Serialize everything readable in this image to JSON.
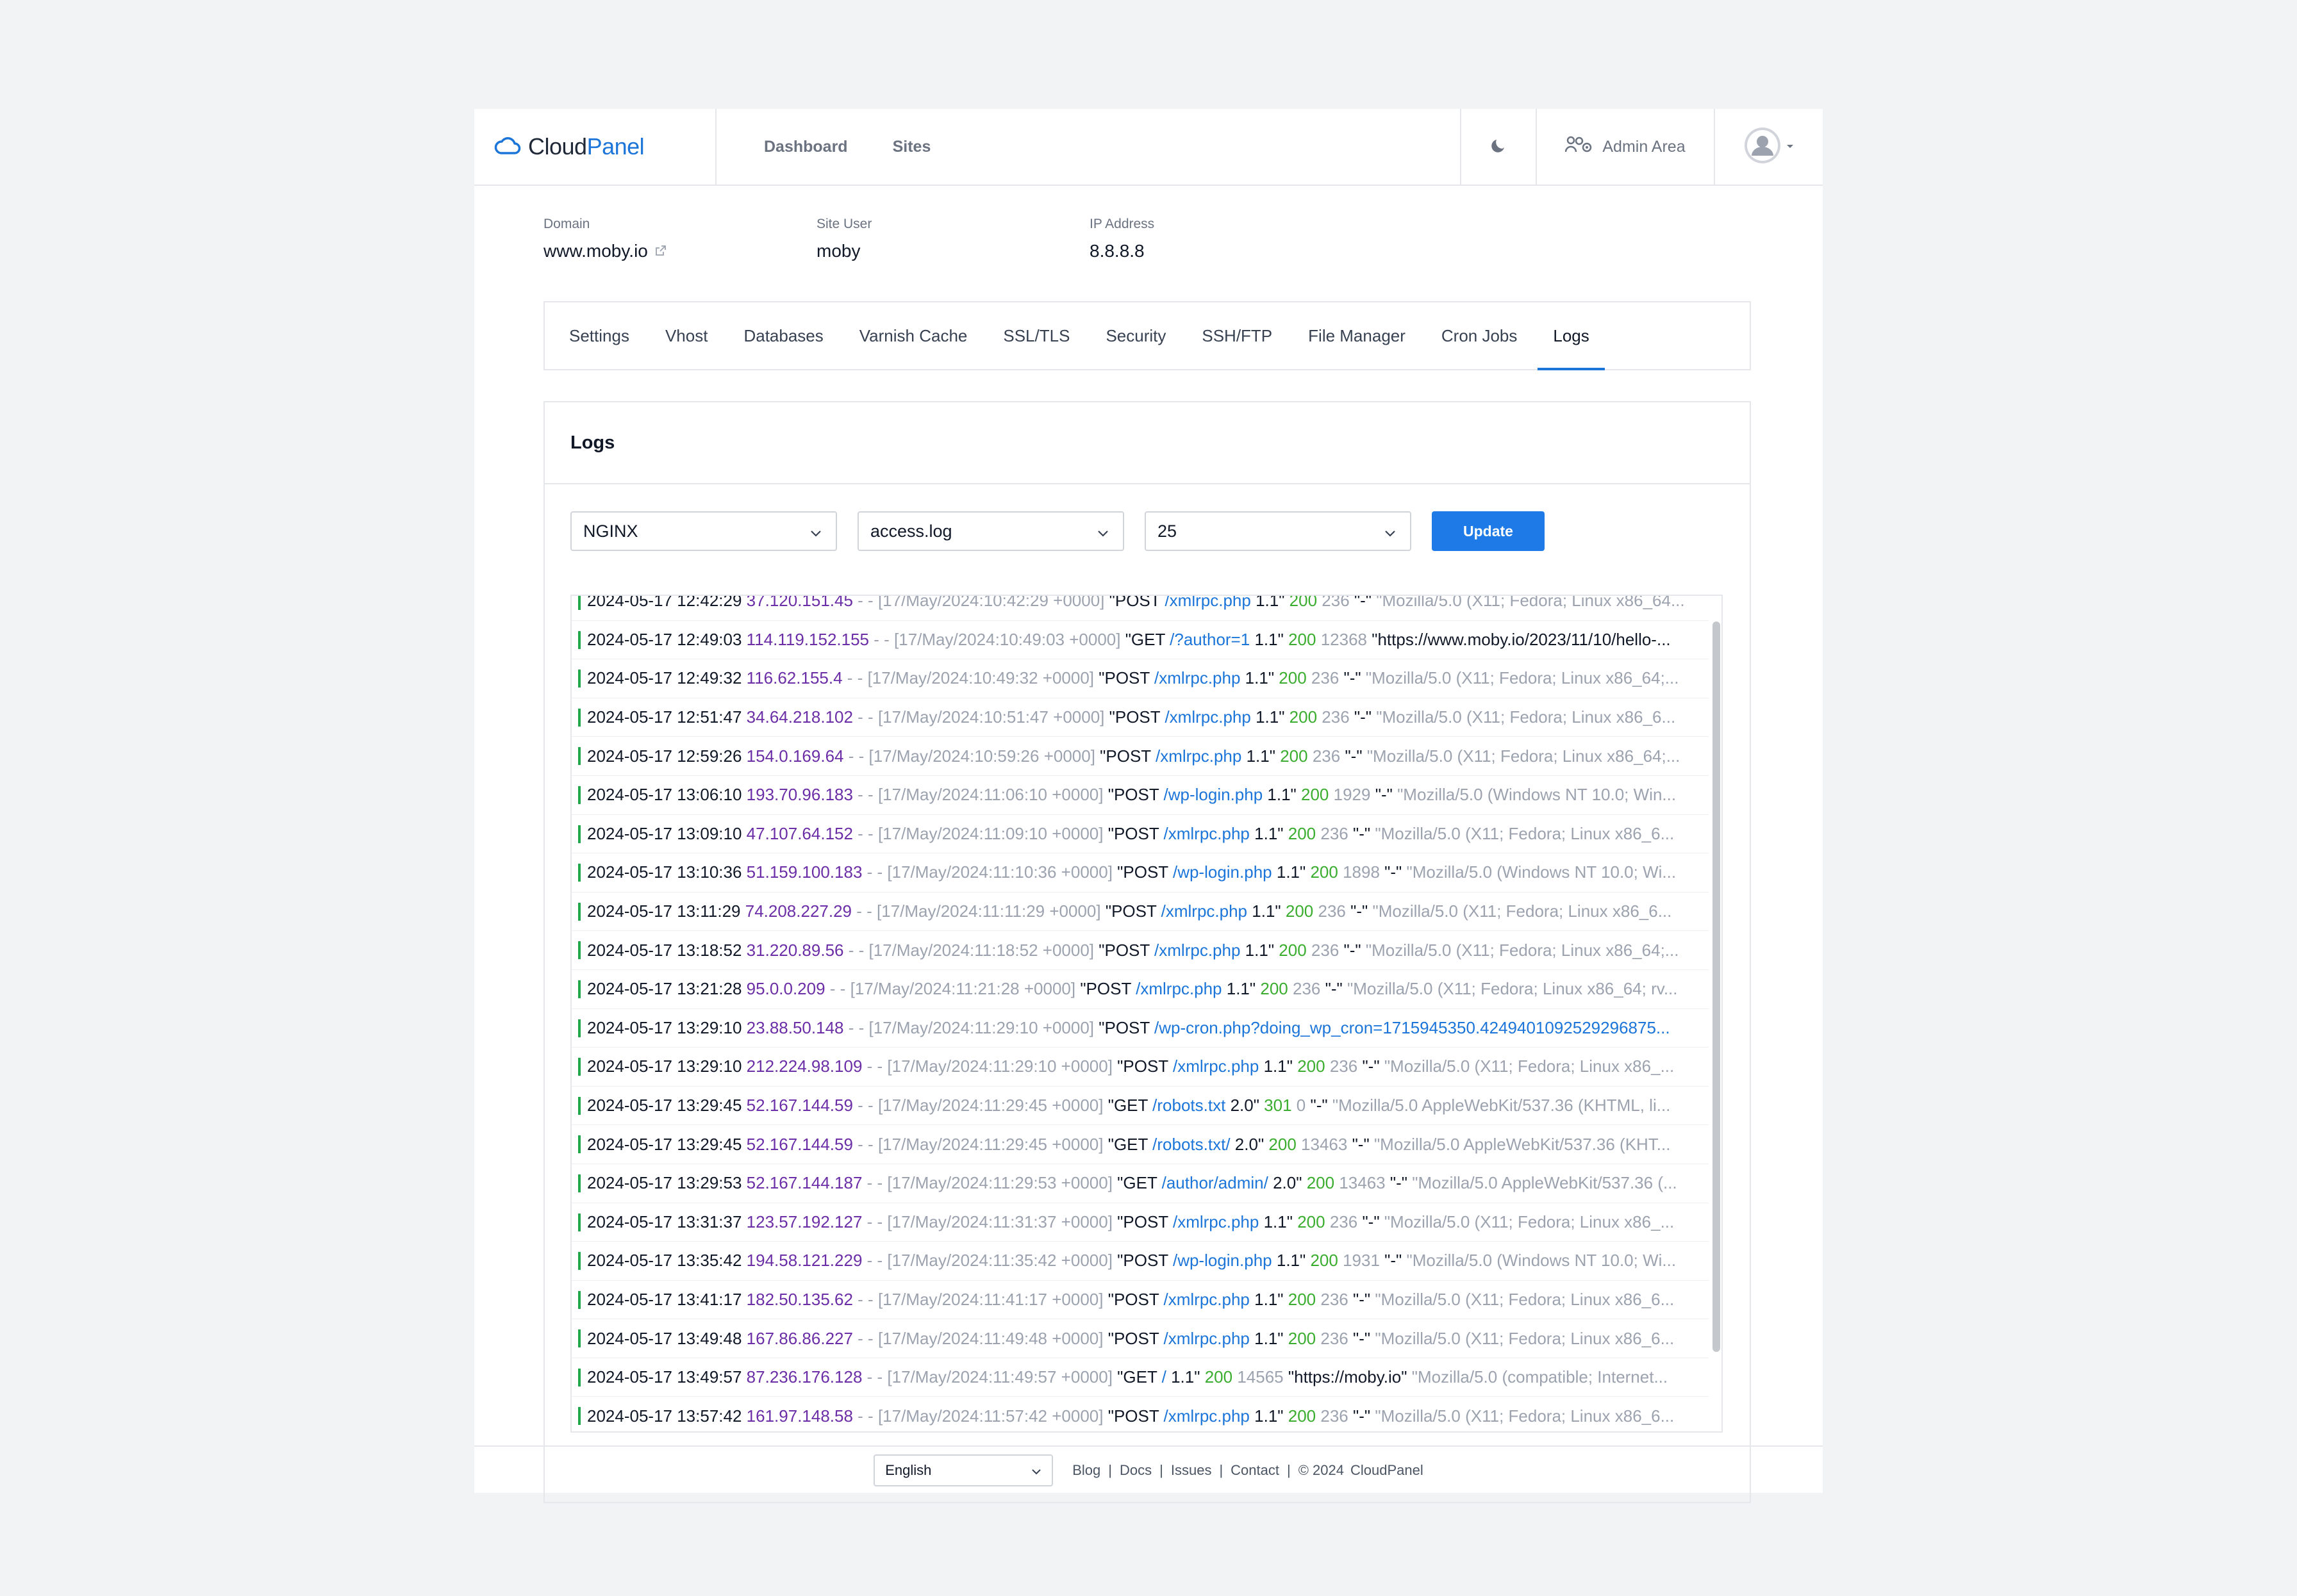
{
  "brand": {
    "part1": "Cloud",
    "part2": "Panel"
  },
  "nav": {
    "dashboard": "Dashboard",
    "sites": "Sites"
  },
  "header": {
    "admin_area": "Admin Area"
  },
  "site": {
    "domain_label": "Domain",
    "domain_value": "www.moby.io",
    "user_label": "Site User",
    "user_value": "moby",
    "ip_label": "IP Address",
    "ip_value": "8.8.8.8"
  },
  "tabs": [
    "Settings",
    "Vhost",
    "Databases",
    "Varnish Cache",
    "SSL/TLS",
    "Security",
    "SSH/FTP",
    "File Manager",
    "Cron Jobs",
    "Logs"
  ],
  "active_tab": "Logs",
  "logs": {
    "title": "Logs",
    "type_select": "NGINX",
    "file_select": "access.log",
    "lines_select": "25",
    "update_label": "Update"
  },
  "log_lines": [
    {
      "ts": "2024-05-17 12:42:29",
      "ip": "37.120.151.45",
      "date": "[17/May/2024:10:42:29 +0000]",
      "method": "\"POST",
      "path": "/xmlrpc.php",
      "proto": "1.1\"",
      "status": "200",
      "size": "236",
      "ref": "\"-\"",
      "ua": "\"Mozilla/5.0 (X11; Fedora; Linux x86_64..."
    },
    {
      "ts": "2024-05-17 12:49:03",
      "ip": "114.119.152.155",
      "date": "[17/May/2024:10:49:03 +0000]",
      "method": "\"GET",
      "path": "/?author=1",
      "proto": "1.1\"",
      "status": "200",
      "size": "12368",
      "ref": "\"https://www.moby.io/2023/11/10/hello-...",
      "ua": ""
    },
    {
      "ts": "2024-05-17 12:49:32",
      "ip": "116.62.155.4",
      "date": "[17/May/2024:10:49:32 +0000]",
      "method": "\"POST",
      "path": "/xmlrpc.php",
      "proto": "1.1\"",
      "status": "200",
      "size": "236",
      "ref": "\"-\"",
      "ua": "\"Mozilla/5.0 (X11; Fedora; Linux x86_64;..."
    },
    {
      "ts": "2024-05-17 12:51:47",
      "ip": "34.64.218.102",
      "date": "[17/May/2024:10:51:47 +0000]",
      "method": "\"POST",
      "path": "/xmlrpc.php",
      "proto": "1.1\"",
      "status": "200",
      "size": "236",
      "ref": "\"-\"",
      "ua": "\"Mozilla/5.0 (X11; Fedora; Linux x86_6..."
    },
    {
      "ts": "2024-05-17 12:59:26",
      "ip": "154.0.169.64",
      "date": "[17/May/2024:10:59:26 +0000]",
      "method": "\"POST",
      "path": "/xmlrpc.php",
      "proto": "1.1\"",
      "status": "200",
      "size": "236",
      "ref": "\"-\"",
      "ua": "\"Mozilla/5.0 (X11; Fedora; Linux x86_64;..."
    },
    {
      "ts": "2024-05-17 13:06:10",
      "ip": "193.70.96.183",
      "date": "[17/May/2024:11:06:10 +0000]",
      "method": "\"POST",
      "path": "/wp-login.php",
      "proto": "1.1\"",
      "status": "200",
      "size": "1929",
      "ref": "\"-\"",
      "ua": "\"Mozilla/5.0 (Windows NT 10.0; Win..."
    },
    {
      "ts": "2024-05-17 13:09:10",
      "ip": "47.107.64.152",
      "date": "[17/May/2024:11:09:10 +0000]",
      "method": "\"POST",
      "path": "/xmlrpc.php",
      "proto": "1.1\"",
      "status": "200",
      "size": "236",
      "ref": "\"-\"",
      "ua": "\"Mozilla/5.0 (X11; Fedora; Linux x86_6..."
    },
    {
      "ts": "2024-05-17 13:10:36",
      "ip": "51.159.100.183",
      "date": "[17/May/2024:11:10:36 +0000]",
      "method": "\"POST",
      "path": "/wp-login.php",
      "proto": "1.1\"",
      "status": "200",
      "size": "1898",
      "ref": "\"-\"",
      "ua": "\"Mozilla/5.0 (Windows NT 10.0; Wi..."
    },
    {
      "ts": "2024-05-17 13:11:29",
      "ip": "74.208.227.29",
      "date": "[17/May/2024:11:11:29 +0000]",
      "method": "\"POST",
      "path": "/xmlrpc.php",
      "proto": "1.1\"",
      "status": "200",
      "size": "236",
      "ref": "\"-\"",
      "ua": "\"Mozilla/5.0 (X11; Fedora; Linux x86_6..."
    },
    {
      "ts": "2024-05-17 13:18:52",
      "ip": "31.220.89.56",
      "date": "[17/May/2024:11:18:52 +0000]",
      "method": "\"POST",
      "path": "/xmlrpc.php",
      "proto": "1.1\"",
      "status": "200",
      "size": "236",
      "ref": "\"-\"",
      "ua": "\"Mozilla/5.0 (X11; Fedora; Linux x86_64;..."
    },
    {
      "ts": "2024-05-17 13:21:28",
      "ip": "95.0.0.209",
      "date": "[17/May/2024:11:21:28 +0000]",
      "method": "\"POST",
      "path": "/xmlrpc.php",
      "proto": "1.1\"",
      "status": "200",
      "size": "236",
      "ref": "\"-\"",
      "ua": "\"Mozilla/5.0 (X11; Fedora; Linux x86_64; rv..."
    },
    {
      "ts": "2024-05-17 13:29:10",
      "ip": "23.88.50.148",
      "date": "[17/May/2024:11:29:10 +0000]",
      "method": "\"POST",
      "path": "/wp-cron.php?doing_wp_cron=1715945350.4249401092529296875...",
      "proto": "",
      "status": "",
      "size": "",
      "ref": "",
      "ua": ""
    },
    {
      "ts": "2024-05-17 13:29:10",
      "ip": "212.224.98.109",
      "date": "[17/May/2024:11:29:10 +0000]",
      "method": "\"POST",
      "path": "/xmlrpc.php",
      "proto": "1.1\"",
      "status": "200",
      "size": "236",
      "ref": "\"-\"",
      "ua": "\"Mozilla/5.0 (X11; Fedora; Linux x86_..."
    },
    {
      "ts": "2024-05-17 13:29:45",
      "ip": "52.167.144.59",
      "date": "[17/May/2024:11:29:45 +0000]",
      "method": "\"GET",
      "path": "/robots.txt",
      "proto": "2.0\"",
      "status": "301",
      "size": "0",
      "ref": "\"-\"",
      "ua": "\"Mozilla/5.0 AppleWebKit/537.36 (KHTML, li..."
    },
    {
      "ts": "2024-05-17 13:29:45",
      "ip": "52.167.144.59",
      "date": "[17/May/2024:11:29:45 +0000]",
      "method": "\"GET",
      "path": "/robots.txt/",
      "proto": "2.0\"",
      "status": "200",
      "size": "13463",
      "ref": "\"-\"",
      "ua": "\"Mozilla/5.0 AppleWebKit/537.36 (KHT..."
    },
    {
      "ts": "2024-05-17 13:29:53",
      "ip": "52.167.144.187",
      "date": "[17/May/2024:11:29:53 +0000]",
      "method": "\"GET",
      "path": "/author/admin/",
      "proto": "2.0\"",
      "status": "200",
      "size": "13463",
      "ref": "\"-\"",
      "ua": "\"Mozilla/5.0 AppleWebKit/537.36 (..."
    },
    {
      "ts": "2024-05-17 13:31:37",
      "ip": "123.57.192.127",
      "date": "[17/May/2024:11:31:37 +0000]",
      "method": "\"POST",
      "path": "/xmlrpc.php",
      "proto": "1.1\"",
      "status": "200",
      "size": "236",
      "ref": "\"-\"",
      "ua": "\"Mozilla/5.0 (X11; Fedora; Linux x86_..."
    },
    {
      "ts": "2024-05-17 13:35:42",
      "ip": "194.58.121.229",
      "date": "[17/May/2024:11:35:42 +0000]",
      "method": "\"POST",
      "path": "/wp-login.php",
      "proto": "1.1\"",
      "status": "200",
      "size": "1931",
      "ref": "\"-\"",
      "ua": "\"Mozilla/5.0 (Windows NT 10.0; Wi..."
    },
    {
      "ts": "2024-05-17 13:41:17",
      "ip": "182.50.135.62",
      "date": "[17/May/2024:11:41:17 +0000]",
      "method": "\"POST",
      "path": "/xmlrpc.php",
      "proto": "1.1\"",
      "status": "200",
      "size": "236",
      "ref": "\"-\"",
      "ua": "\"Mozilla/5.0 (X11; Fedora; Linux x86_6..."
    },
    {
      "ts": "2024-05-17 13:49:48",
      "ip": "167.86.86.227",
      "date": "[17/May/2024:11:49:48 +0000]",
      "method": "\"POST",
      "path": "/xmlrpc.php",
      "proto": "1.1\"",
      "status": "200",
      "size": "236",
      "ref": "\"-\"",
      "ua": "\"Mozilla/5.0 (X11; Fedora; Linux x86_6..."
    },
    {
      "ts": "2024-05-17 13:49:57",
      "ip": "87.236.176.128",
      "date": "[17/May/2024:11:49:57 +0000]",
      "method": "\"GET",
      "path": "/",
      "proto": "1.1\"",
      "status": "200",
      "size": "14565",
      "ref": "\"https://moby.io\"",
      "ua": "\"Mozilla/5.0 (compatible; Internet..."
    },
    {
      "ts": "2024-05-17 13:57:42",
      "ip": "161.97.148.58",
      "date": "[17/May/2024:11:57:42 +0000]",
      "method": "\"POST",
      "path": "/xmlrpc.php",
      "proto": "1.1\"",
      "status": "200",
      "size": "236",
      "ref": "\"-\"",
      "ua": "\"Mozilla/5.0 (X11; Fedora; Linux x86_6..."
    }
  ],
  "footer": {
    "language": "English",
    "links": [
      "Blog",
      "Docs",
      "Issues",
      "Contact"
    ],
    "copyright": "© 2024",
    "brand": "CloudPanel"
  },
  "colors": {
    "accent": "#1c75d8",
    "ip": "#6b2ea6",
    "status_ok": "#3aad2f",
    "row_marker": "#22a84a"
  }
}
